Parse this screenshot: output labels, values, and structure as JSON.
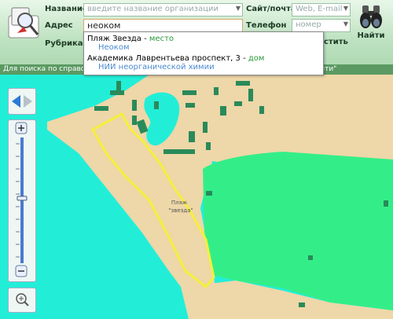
{
  "search": {
    "name_label": "Название",
    "name_placeholder": "введите название организации",
    "address_label": "Адрес",
    "address_value": "неоком",
    "rubric_label": "Рубрика",
    "site_label": "Сайт/почта",
    "site_placeholder": "Web, E-mail",
    "phone_label": "Телефон",
    "phone_placeholder": "номер",
    "find_label": "Найти",
    "clear_label": "истить"
  },
  "hint": "Для поиска по справочнику введите текст в поле \"Название\" и нажмите кнопку \"Найти\"",
  "suggestions": [
    {
      "title": "Пляж Звезда",
      "kind": "место",
      "sub": "Неоком"
    },
    {
      "title": "Академика Лаврентьева проспект, 3",
      "kind": "дом",
      "sub": "НИИ неорганической химии"
    }
  ],
  "map": {
    "place_label_1": "Пляж",
    "place_label_2": "\"звезда\"",
    "colors": {
      "water": "#22eed8",
      "land": "#eed7a8",
      "forest": "#33ee88",
      "building": "#2a8a5a",
      "highlight": "#f5f03a"
    }
  },
  "controls": {
    "back_icon": "arrow-left-icon",
    "forward_icon": "arrow-right-icon",
    "zoom_in_icon": "plus-icon",
    "zoom_out_icon": "minus-icon",
    "magnifier_icon": "magnifier-icon",
    "zoom_level": 0.52
  }
}
